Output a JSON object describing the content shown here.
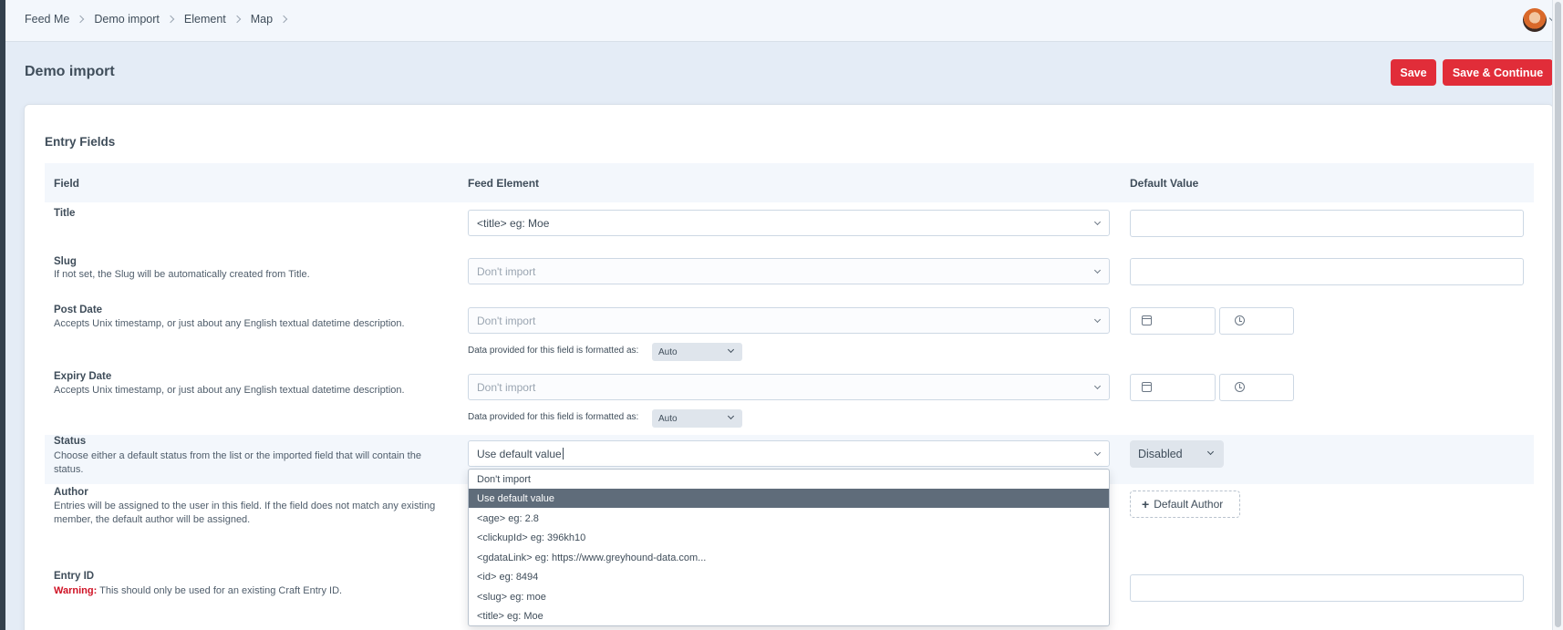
{
  "breadcrumb": [
    "Feed Me",
    "Demo import",
    "Element",
    "Map"
  ],
  "page": {
    "title": "Demo import",
    "save_label": "Save",
    "save_continue_label": "Save & Continue"
  },
  "section": {
    "title": "Entry Fields"
  },
  "table": {
    "headers": {
      "field": "Field",
      "feed_element": "Feed Element",
      "default_value": "Default Value"
    }
  },
  "fields": {
    "title": {
      "label": "Title",
      "select_value": "<title> eg: Moe"
    },
    "slug": {
      "label": "Slug",
      "desc": "If not set, the Slug will be automatically created from Title.",
      "select_value": "Don't import"
    },
    "post_date": {
      "label": "Post Date",
      "desc": "Accepts Unix timestamp, or just about any English textual datetime description.",
      "select_value": "Don't import",
      "format_label": "Data provided for this field is formatted as:",
      "format_value": "Auto"
    },
    "expiry_date": {
      "label": "Expiry Date",
      "desc": "Accepts Unix timestamp, or just about any English textual datetime description.",
      "select_value": "Don't import",
      "format_label": "Data provided for this field is formatted as:",
      "format_value": "Auto"
    },
    "status": {
      "label": "Status",
      "desc": "Choose either a default status from the list or the imported field that will contain the status.",
      "select_value": "Use default value",
      "default_value": "Disabled"
    },
    "author": {
      "label": "Author",
      "desc": "Entries will be assigned to the user in this field. If the field does not match any existing member, the default author will be assigned.",
      "default_button": "Default Author"
    },
    "entry_id": {
      "label": "Entry ID",
      "warning": "Warning:",
      "desc": " This should only be used for an existing Craft Entry ID."
    }
  },
  "dropdown": {
    "options": [
      "Don't import",
      "Use default value",
      "<age> eg: 2.8",
      "<clickupId> eg: 396kh10",
      "<gdataLink> eg: https://www.greyhound-data.com...",
      "<id> eg: 8494",
      "<slug> eg: moe",
      "<title> eg: Moe"
    ],
    "active_index": 1
  }
}
